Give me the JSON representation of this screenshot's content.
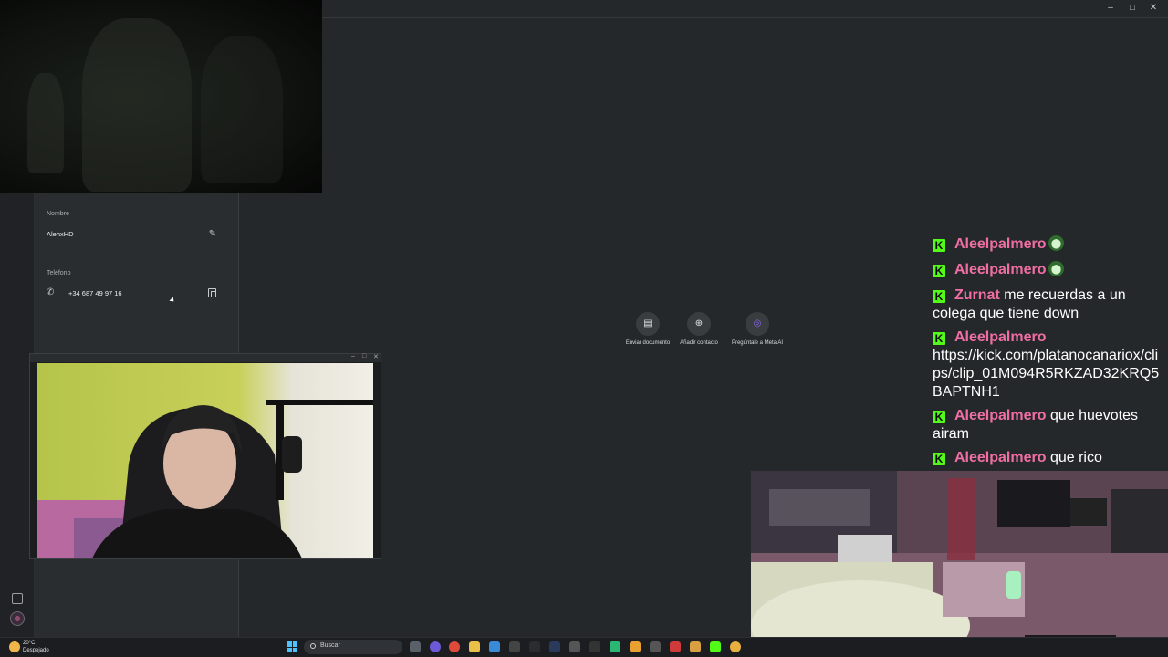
{
  "window": {
    "controls": [
      "–",
      "□",
      "✕"
    ]
  },
  "profile": {
    "name_label": "Nombre",
    "name_value": "AlehxHD",
    "phone_label": "Teléfono",
    "phone_value": "+34 687 49 97 16"
  },
  "actions": [
    {
      "label": "Enviar documento",
      "icon": "document-icon"
    },
    {
      "label": "Añadir contacto",
      "icon": "add-contact-icon"
    },
    {
      "label": "Pregúntale a Meta AI",
      "icon": "meta-ai-icon"
    }
  ],
  "mini_window": {
    "controls": [
      "–",
      "□",
      "✕"
    ]
  },
  "chat": {
    "messages": [
      {
        "user": "Aleelpalmero",
        "text": "",
        "emote": true
      },
      {
        "user": "Aleelpalmero",
        "text": "",
        "emote": true
      },
      {
        "user": "Zurnat",
        "text": "me recuerdas a un colega que tiene down",
        "emote": false
      },
      {
        "user": "Aleelpalmero",
        "text": "https://kick.com/platanocanariox/clips/clip_01M094R5RKZAD32KRQ5BAPTNH1",
        "emote": false
      },
      {
        "user": "Aleelpalmero",
        "text": "que huevotes airam",
        "emote": false
      },
      {
        "user": "Aleelpalmero",
        "text": "que rico",
        "emote": false
      }
    ],
    "badge": "K"
  },
  "taskbar": {
    "weather_temp": "20°C",
    "weather_condition": "Despejado",
    "search_placeholder": "Buscar"
  },
  "colors": {
    "kick_green": "#53fc18",
    "username_pink": "#ef6fa4",
    "meta_ai_purple": "#8c6cf0"
  }
}
